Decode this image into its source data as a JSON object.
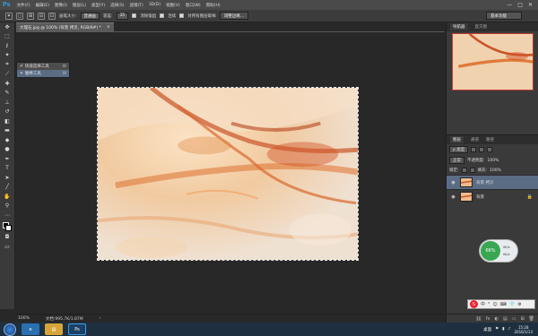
{
  "app": {
    "logo": "Ps"
  },
  "menu": [
    "文件(F)",
    "编辑(E)",
    "图像(I)",
    "图层(L)",
    "类型(Y)",
    "选择(S)",
    "滤镜(T)",
    "3D(D)",
    "视图(V)",
    "窗口(W)",
    "帮助(H)"
  ],
  "window_controls": [
    "—",
    "□",
    "✕"
  ],
  "options": {
    "brush_size_label": "画笔大小:",
    "brush_value": "普通画",
    "tolerance_label": "容差:",
    "tolerance_value": "35",
    "antialias_label": "消除锯齿",
    "contiguous_label": "连续",
    "sample_all_label": "对所有图层取样",
    "refine_edge_button": "调整边缘...",
    "workspace": "基本功能"
  },
  "document_tab": {
    "title": "大理石.jpg @ 100% (背景 拷贝, RGB/8#) *",
    "close": "×"
  },
  "tool_flyout": {
    "items": [
      {
        "label": "快速选择工具",
        "key": "W"
      },
      {
        "label": "魔棒工具",
        "key": "W"
      }
    ]
  },
  "status_bar": {
    "zoom": "100%",
    "doc_info": "文档:995.7K/1.87M",
    "arrow": "›"
  },
  "panels": {
    "navigator_tabs": [
      "导航器",
      "直方图"
    ],
    "layers_tabs": [
      "图层",
      "通道",
      "路径"
    ],
    "kind_filter": "ρ 类型",
    "blend_mode": "正常",
    "opacity_label": "不透明度:",
    "opacity_value": "100%",
    "lock_label": "锁定:",
    "fill_label": "填充:",
    "fill_value": "100%",
    "layers": [
      {
        "name": "背景 拷贝",
        "selected": true,
        "locked": false
      },
      {
        "name": "背景",
        "selected": false,
        "locked": true
      }
    ],
    "footer_icons": [
      "⛓",
      "fx",
      "◐",
      "▤",
      "▭",
      "⊞",
      "🗑"
    ]
  },
  "network_widget": {
    "percent": "66%",
    "up": "0K/s",
    "down": "0K/s"
  },
  "ime_bar": {
    "logo": "S",
    "items": [
      "中",
      "°",
      "☺",
      "⌨",
      "👕",
      "⚙"
    ]
  },
  "taskbar": {
    "tray_text": "桌面",
    "time": "15:28",
    "date": "2016/1/13"
  },
  "colors": {
    "accent": "#3aa0e8",
    "selection": "#5a6d85",
    "chrome": "#3a3a3a",
    "canvas_bg": "#282828"
  }
}
